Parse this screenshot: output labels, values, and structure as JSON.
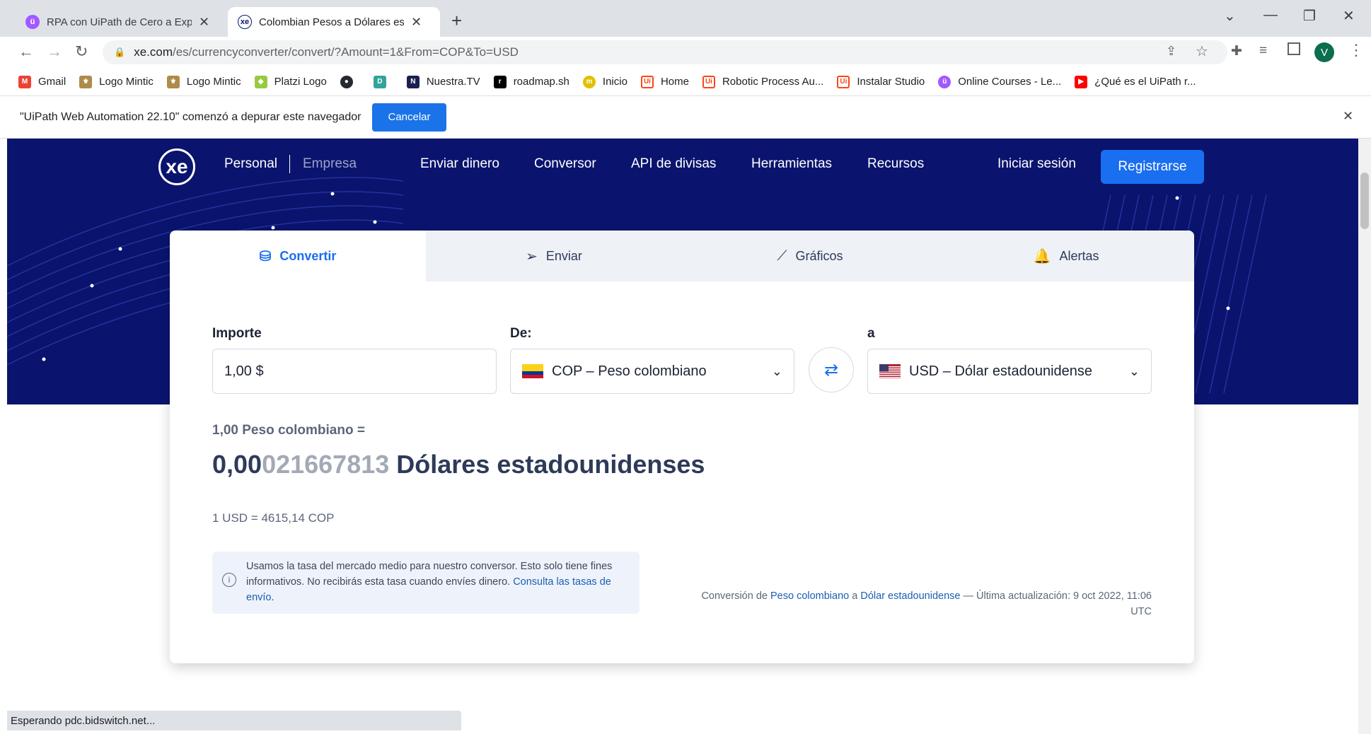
{
  "browser": {
    "tabs": [
      {
        "title": "RPA con UiPath de Cero a Experto",
        "active": false
      },
      {
        "title": "Colombian Pesos a Dólares estadounidenses",
        "active": true
      }
    ],
    "new_tab": "+",
    "url_host": "xe.com",
    "url_path": "/es/currencyconverter/convert/?Amount=1&From=COP&To=USD",
    "profile_initial": "V",
    "bookmarks": [
      "Gmail",
      "Logo Mintic",
      "Logo Mintic",
      "Platzi Logo",
      "",
      "",
      "Nuestra.TV",
      "roadmap.sh",
      "Inicio",
      "Home",
      "Robotic Process Au...",
      "Instalar Studio",
      "Online Courses - Le...",
      "¿Qué es el UiPath r..."
    ],
    "infobar_text": "\"UiPath Web Automation 22.10\" comenzó a depurar este navegador",
    "infobar_button": "Cancelar",
    "status_text": "Esperando pdc.bidswitch.net..."
  },
  "site": {
    "logo": "xe",
    "segment_personal": "Personal",
    "segment_business": "Empresa",
    "nav": [
      "Enviar dinero",
      "Conversor",
      "API de divisas",
      "Herramientas",
      "Recursos"
    ],
    "login": "Iniciar sesión",
    "register": "Registrarse"
  },
  "converter": {
    "tabs": [
      "Convertir",
      "Enviar",
      "Gráficos",
      "Alertas"
    ],
    "amount_label": "Importe",
    "amount_value": "1,00  $",
    "from_label": "De:",
    "from_value": "COP – Peso colombiano",
    "to_label": "a",
    "to_value": "USD – Dólar estadounidense",
    "result_from": "1,00 Peso colombiano =",
    "result_main": "0,00",
    "result_faded": "021667813",
    "result_unit": " Dólares estadounidenses",
    "rate": "1 USD = 4615,14 COP",
    "disclaimer": "Usamos la tasa del mercado medio para nuestro conversor. Esto solo tiene fines informativos. No recibirás esta tasa cuando envíes dinero.",
    "disclaimer_link": "Consulta las tasas de envío",
    "footer_prefix": "Conversión de",
    "footer_from_link": "Peso colombiano",
    "footer_mid": "a",
    "footer_to_link": "Dólar estadounidense",
    "footer_suffix": "— Última actualización: 9 oct 2022, 11:06 UTC"
  },
  "colors": {
    "hero": "#0a146e",
    "accent": "#1a6ef0"
  }
}
